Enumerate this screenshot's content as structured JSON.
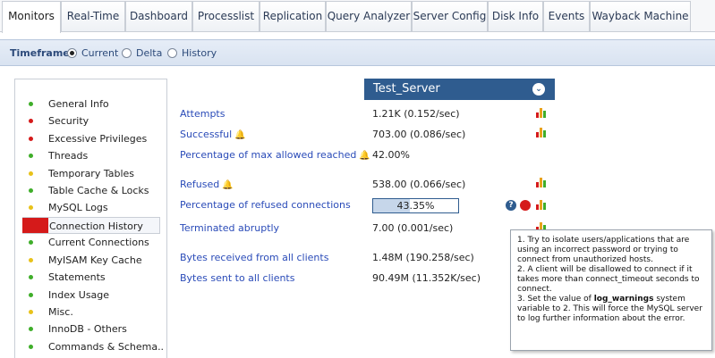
{
  "tabs": [
    {
      "label": "Monitors",
      "active": true
    },
    {
      "label": "Real-Time",
      "active": false
    },
    {
      "label": "Dashboard",
      "active": false
    },
    {
      "label": "Processlist",
      "active": false
    },
    {
      "label": "Replication",
      "active": false
    },
    {
      "label": "Query Analyzer",
      "active": false
    },
    {
      "label": "Server Config",
      "active": false
    },
    {
      "label": "Disk Info",
      "active": false
    },
    {
      "label": "Events",
      "active": false
    },
    {
      "label": "Wayback Machine",
      "active": false
    }
  ],
  "timeframe": {
    "label": "Timeframe",
    "options": [
      "Current",
      "Delta",
      "History"
    ],
    "selected": "Current"
  },
  "colors": {
    "status_green": "#3fae2a",
    "status_red": "#d51a1a",
    "status_yellow": "#e8c21a",
    "link_blue": "#2a4bb8",
    "header_blue": "#2f5c8f"
  },
  "sidebar": {
    "items": [
      {
        "label": "General Info",
        "status": "green"
      },
      {
        "label": "Security",
        "status": "red"
      },
      {
        "label": "Excessive Privileges",
        "status": "red"
      },
      {
        "label": "Threads",
        "status": "green"
      },
      {
        "label": "Temporary Tables",
        "status": "yellow"
      },
      {
        "label": "Table Cache & Locks",
        "status": "green"
      },
      {
        "label": "MySQL Logs",
        "status": "yellow"
      },
      {
        "label": "Connection History",
        "status": "red",
        "active": true
      },
      {
        "label": "Current Connections",
        "status": "green"
      },
      {
        "label": "MyISAM Key Cache",
        "status": "yellow"
      },
      {
        "label": "Statements",
        "status": "green"
      },
      {
        "label": "Index Usage",
        "status": "green"
      },
      {
        "label": "Misc.",
        "status": "yellow"
      },
      {
        "label": "InnoDB - Others",
        "status": "green"
      },
      {
        "label": "Commands & Schema..",
        "status": "green"
      }
    ]
  },
  "server": {
    "name": "Test_Server",
    "menu_icon": "chevron-down-icon"
  },
  "metrics": [
    {
      "label": "Attempts",
      "value": "1.21K (0.152/sec)",
      "bell": false,
      "chart": true
    },
    {
      "label": "Successful",
      "value": "703.00 (0.086/sec)",
      "bell": true,
      "chart": true
    },
    {
      "label": "Percentage of max allowed reached",
      "value": "42.00%",
      "bell": true,
      "chart": false
    },
    {
      "label": "Refused",
      "value": "538.00 (0.066/sec)",
      "bell": true,
      "chart": true
    },
    {
      "label": "Percentage of refused connections",
      "value": "43.35%",
      "progress": 0.4335,
      "bell": false,
      "chart": true
    },
    {
      "label": "Terminated abruptly",
      "value": "7.00 (0.001/sec)",
      "bell": false,
      "chart": true
    },
    {
      "label": "Bytes received from all clients",
      "value": "1.48M (190.258/sec)",
      "bell": false,
      "chart": false
    },
    {
      "label": "Bytes sent to all clients",
      "value": "90.49M (11.352K/sec)",
      "bell": false,
      "chart": false
    }
  ],
  "tooltip": {
    "line1": "1. Try to isolate users/applications that are using an incorrect password or trying to connect from unauthorized hosts.",
    "line2": "2. A client will be disallowed to connect if it takes more than connect_timeout seconds to connect.",
    "line3_pre": "3. Set the value of ",
    "line3_bold": "log_warnings",
    "line3_post": " system variable to 2. This will force the MySQL server to log further information about the error."
  }
}
